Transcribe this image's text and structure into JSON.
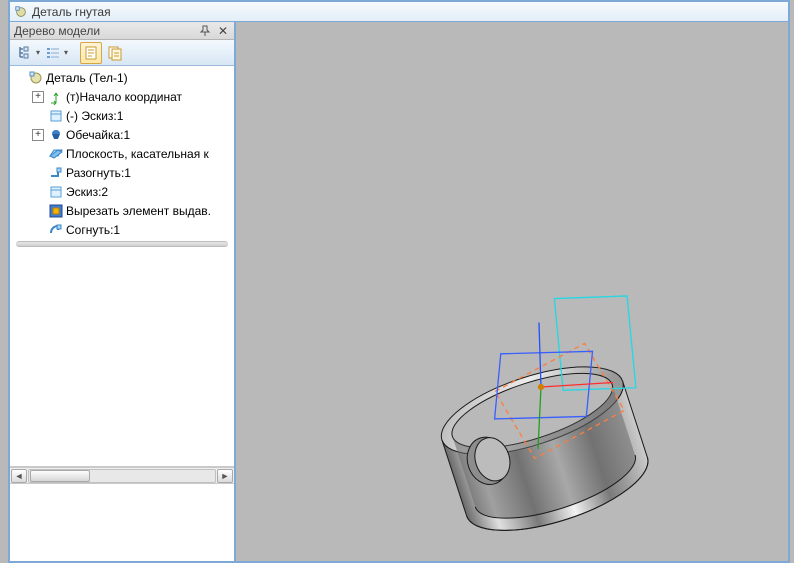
{
  "window": {
    "title": "Деталь гнутая"
  },
  "panel": {
    "title": "Дерево модели"
  },
  "tree": {
    "root": {
      "label": "Деталь (Тел-1)"
    },
    "items": [
      {
        "label": "(т)Начало координат",
        "kind": "origin",
        "expandable": true
      },
      {
        "label": "(-) Эскиз:1",
        "kind": "sketch",
        "expandable": false
      },
      {
        "label": "Обечайка:1",
        "kind": "shell",
        "expandable": true
      },
      {
        "label": "Плоскость, касательная к",
        "kind": "plane",
        "expandable": false
      },
      {
        "label": "Разогнуть:1",
        "kind": "unbend",
        "expandable": false
      },
      {
        "label": "Эскиз:2",
        "kind": "sketch",
        "expandable": false
      },
      {
        "label": "Вырезать элемент выдав.",
        "kind": "cut",
        "expandable": false
      },
      {
        "label": "Согнуть:1",
        "kind": "bend",
        "expandable": false
      }
    ]
  }
}
